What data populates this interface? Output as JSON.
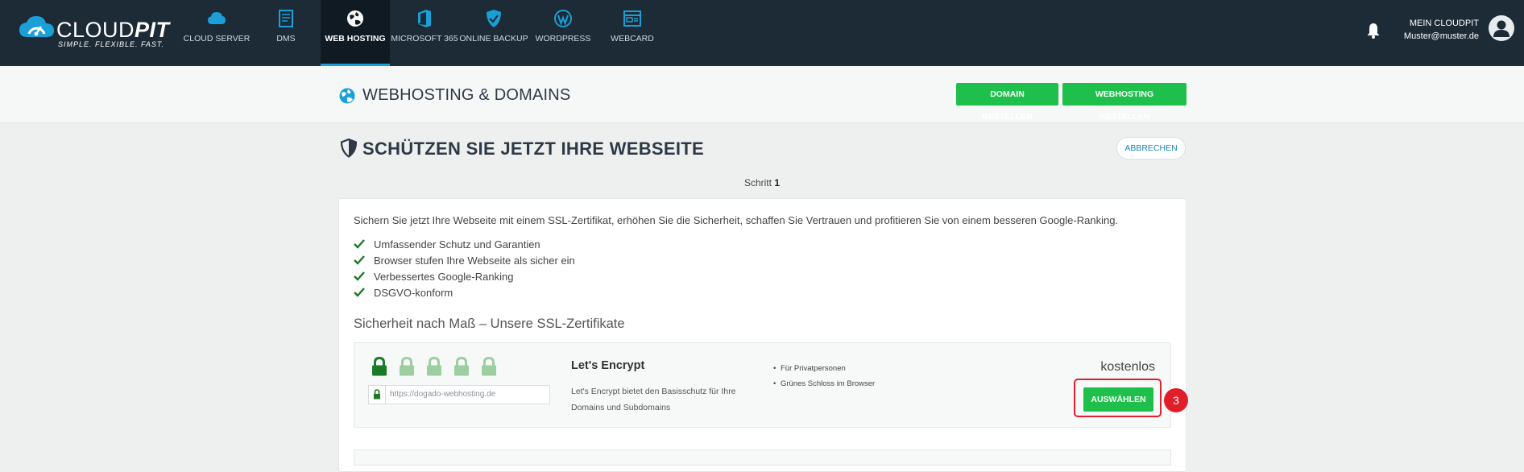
{
  "brand": {
    "name_light": "CLOUD",
    "name_bold": "PIT",
    "tagline": "SIMPLE. FLEXIBLE. FAST.",
    "accent": "#1a9fd6"
  },
  "nav": {
    "items": [
      {
        "label": "CLOUD SERVER",
        "icon": "cloud-icon"
      },
      {
        "label": "DMS",
        "icon": "document-icon"
      },
      {
        "label": "WEB HOSTING",
        "icon": "globe-icon",
        "active": true
      },
      {
        "label": "MICROSOFT 365",
        "icon": "office-icon"
      },
      {
        "label": "ONLINE BACKUP",
        "icon": "shield-check-icon"
      },
      {
        "label": "WORDPRESS",
        "icon": "wordpress-icon"
      },
      {
        "label": "WEBCARD",
        "icon": "card-icon"
      }
    ]
  },
  "account": {
    "title": "MEIN CLOUDPIT",
    "email": "Muster@muster.de"
  },
  "subheader": {
    "title": "WEBHOSTING & DOMAINS",
    "order_domain": "DOMAIN BESTELLEN",
    "order_hosting": "WEBHOSTING BESTELLEN"
  },
  "page": {
    "title": "SCHÜTZEN SIE JETZT IHRE WEBSEITE",
    "cancel": "ABBRECHEN",
    "step_label": "Schritt",
    "step_number": "1"
  },
  "content": {
    "intro": "Sichern Sie jetzt Ihre Webseite mit einem SSL-Zertifikat, erhöhen Sie die Sicherheit, schaffen Sie Vertrauen und profitieren Sie von einem besseren Google-Ranking.",
    "benefits": [
      "Umfassender Schutz und Garantien",
      "Browser stufen Ihre Webseite als sicher ein",
      "Verbessertes Google-Ranking",
      "DSGVO-konform"
    ],
    "section_heading": "Sicherheit nach Maß – Unsere SSL-Zertifikate"
  },
  "certificate": {
    "name": "Let's Encrypt",
    "description": "Let's Encrypt bietet den Basisschutz für Ihre Domains und Subdomains",
    "features": [
      "Für Privatpersonen",
      "Grünes Schloss im Browser"
    ],
    "price": "kostenlos",
    "select": "AUSWÄHLEN",
    "url_example": "https://dogado-webhosting.de",
    "security_level": 1,
    "security_max": 5,
    "lock_active_color": "#1a7a26",
    "lock_inactive_color": "#9ccf9f"
  },
  "annotation": {
    "step_badge": "3",
    "color": "#e0202d"
  }
}
